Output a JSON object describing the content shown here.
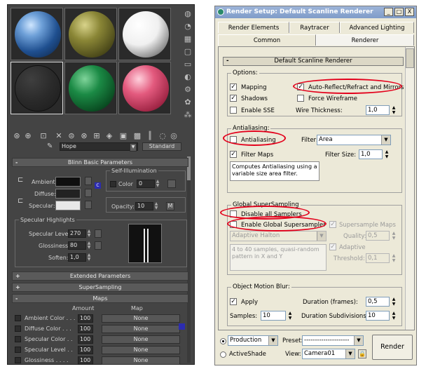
{
  "material_editor": {
    "material_name": "Hope",
    "material_type": "Standard",
    "rollouts": {
      "blinn_basic": "Blinn Basic Parameters",
      "extended": "Extended Parameters",
      "supersampling": "SuperSampling",
      "maps": "Maps"
    },
    "blinn": {
      "ambient_label": "Ambient:",
      "diffuse_label": "Diffuse:",
      "specular_label": "Specular:",
      "self_illum_title": "Self-Illumination",
      "color_label": "Color",
      "color_value": "0",
      "opacity_label": "Opacity:",
      "opacity_value": "10",
      "opacity_map_btn": "M",
      "lock_icon_text": "C",
      "colors": {
        "ambient": "#0f0f0f",
        "diffuse": "#222222",
        "specular": "#e8e8e8"
      }
    },
    "specular_highlights": {
      "title": "Specular Highlights",
      "level_label": "Specular Level:",
      "level_value": "270",
      "gloss_label": "Glossiness:",
      "gloss_value": "80",
      "soften_label": "Soften:",
      "soften_value": "1,0"
    },
    "maps": {
      "amount_header": "Amount",
      "map_header": "Map",
      "rows": [
        {
          "name": "Ambient Color . . .",
          "amount": "100",
          "map": "None"
        },
        {
          "name": "Diffuse Color . . .",
          "amount": "100",
          "map": "None"
        },
        {
          "name": "Specular Color . .",
          "amount": "100",
          "map": "None"
        },
        {
          "name": "Specular Level . .",
          "amount": "100",
          "map": "None"
        },
        {
          "name": "Glossiness . . . .",
          "amount": "100",
          "map": "None"
        }
      ]
    },
    "slot_colors": [
      "#2a5c9a",
      "#7d7a2c",
      "#e8e8e8",
      "#333333",
      "#0f6b33",
      "#d8456b"
    ]
  },
  "render_setup": {
    "title": "Render Setup: Default Scanline Renderer",
    "tabs_row1": [
      "Render Elements",
      "Raytracer",
      "Advanced Lighting"
    ],
    "tabs_row2": [
      "Common",
      "Renderer"
    ],
    "rollout_title": "Default Scanline Renderer",
    "options": {
      "title": "Options:",
      "mapping": "Mapping",
      "auto_reflect": "Auto-Reflect/Refract and Mirrors",
      "shadows": "Shadows",
      "force_wireframe": "Force Wireframe",
      "enable_sse": "Enable SSE",
      "wire_thickness_label": "Wire Thickness:",
      "wire_thickness_value": "1,0"
    },
    "antialiasing": {
      "title": "Antialiasing:",
      "antialiasing": "Antialiasing",
      "filter_label": "Filter:",
      "filter_value": "Area",
      "filter_maps": "Filter Maps",
      "filter_size_label": "Filter Size:",
      "filter_size_value": "1,0",
      "description": "Computes Antialiasing using a variable size area filter."
    },
    "global_supersampling": {
      "title": "Global SuperSampling",
      "disable_all": "Disable all Samplers",
      "enable_global": "Enable Global Supersampler",
      "supersample_maps": "Supersample Maps",
      "sampler_value": "Adaptive Halton",
      "quality_label": "Quality:",
      "quality_value": "0,5",
      "adaptive": "Adaptive",
      "threshold_label": "Threshold:",
      "threshold_value": "0,1",
      "description": "4 to 40 samples, quasi-random pattern in X and Y"
    },
    "motion_blur": {
      "title": "Object Motion Blur:",
      "apply": "Apply",
      "duration_label": "Duration (frames):",
      "duration_value": "0,5",
      "samples_label": "Samples:",
      "samples_value": "10",
      "subdiv_label": "Duration Subdivisions:",
      "subdiv_value": "10"
    },
    "footer": {
      "production": "Production",
      "activeshade": "ActiveShade",
      "preset_label": "Preset:",
      "preset_value": "---------------------",
      "view_label": "View:",
      "view_value": "Camera01",
      "render_btn": "Render"
    },
    "window_buttons": [
      "_",
      "□",
      "X"
    ]
  }
}
